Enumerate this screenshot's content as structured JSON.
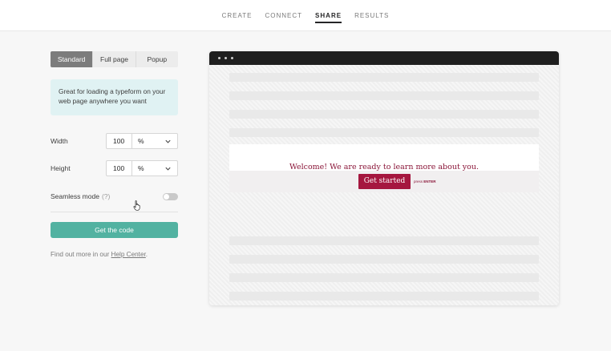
{
  "nav": {
    "items": [
      "CREATE",
      "CONNECT",
      "SHARE",
      "RESULTS"
    ],
    "active": "SHARE"
  },
  "embed_types": {
    "options": [
      "Standard",
      "Full page",
      "Popup"
    ],
    "selected": "Standard"
  },
  "info_text": "Great for loading a typeform on your web page anywhere you want",
  "width": {
    "label": "Width",
    "value": "100",
    "unit": "%"
  },
  "height": {
    "label": "Height",
    "value": "100",
    "unit": "%"
  },
  "seamless": {
    "label": "Seamless mode",
    "help": "(?)",
    "enabled": false
  },
  "get_code_label": "Get the code",
  "find_out": {
    "prefix": "Find out more in our ",
    "link": "Help Center",
    "suffix": "."
  },
  "preview": {
    "welcome": "Welcome! We are ready to learn more about you.",
    "button": "Get started",
    "press": "press",
    "key": "ENTER"
  },
  "colors": {
    "accent_green": "#52b2a1",
    "typeform_red": "#a5173f",
    "info_bg": "#e0f2f3"
  }
}
